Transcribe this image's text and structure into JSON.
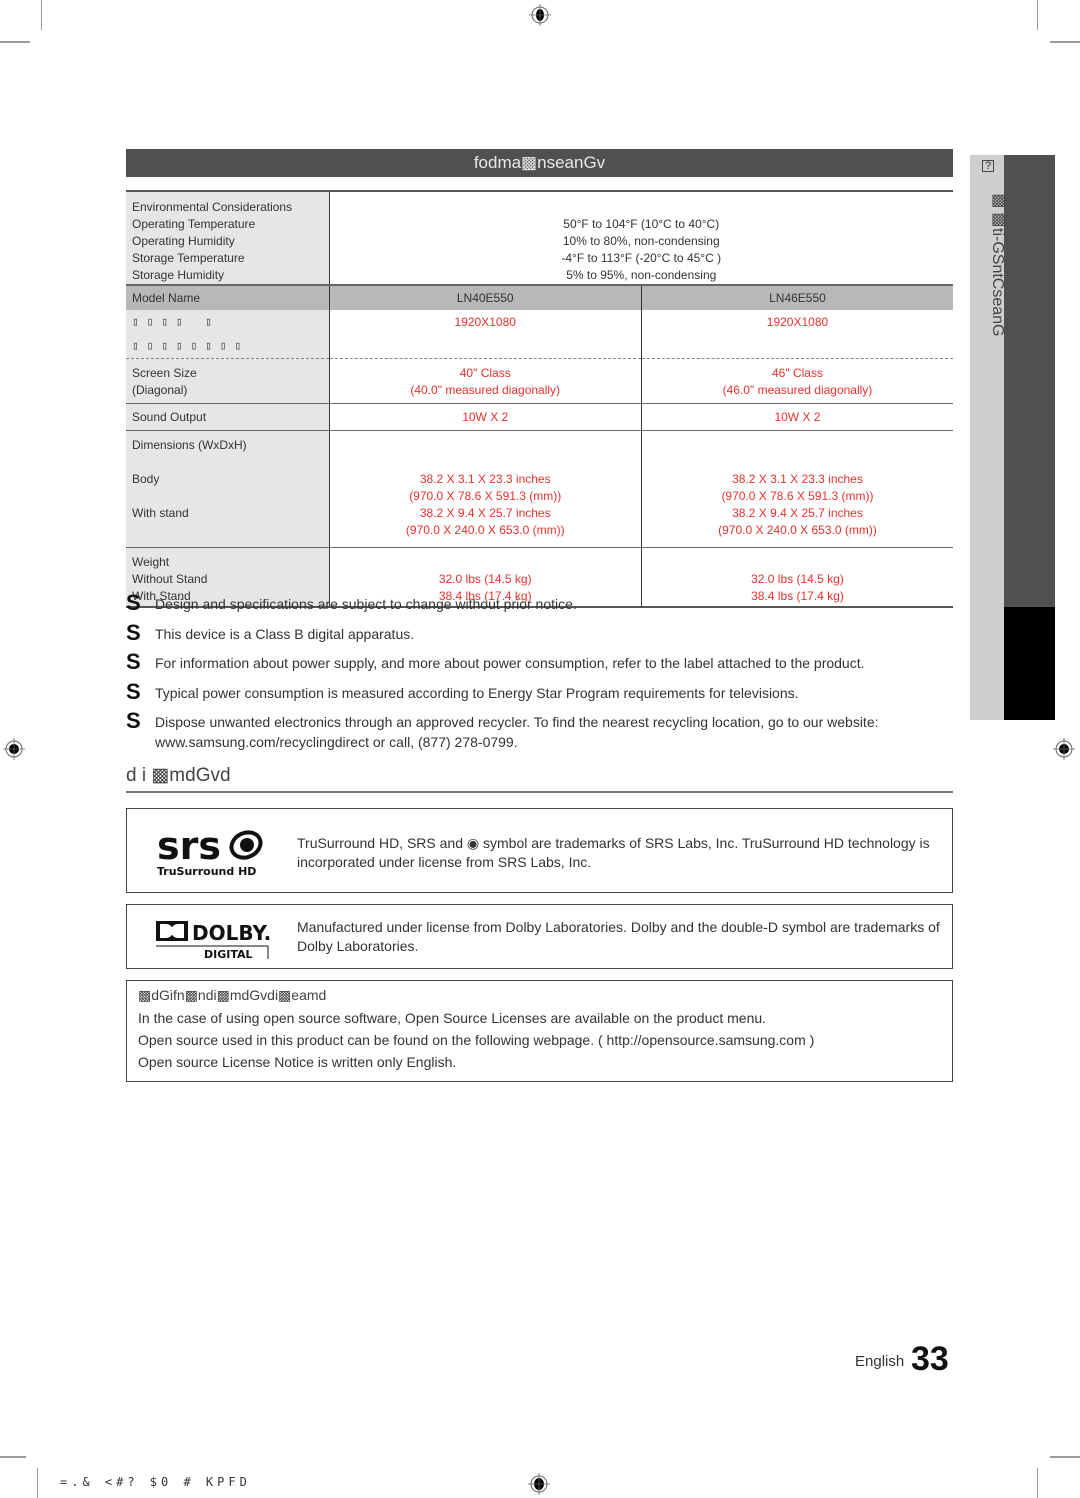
{
  "header": {
    "title": "fodma▩nseanGv"
  },
  "environmental": {
    "labels": [
      "Environmental Considerations",
      "Operating Temperature",
      "Operating Humidity",
      "Storage Temperature",
      "Storage Humidity"
    ],
    "values": [
      "",
      "50°F to 104°F (10°C to 40°C)",
      "10% to 80%, non-condensing",
      "-4°F to 113°F (-20°C to 45°C )",
      "5% to 95%, non-condensing"
    ]
  },
  "models": {
    "label": "Model Name",
    "names": [
      "LN40E550",
      "LN46E550"
    ]
  },
  "resolution": {
    "label": "▯▯▯▯ ▯ ▯▯▯▯▯▯▯▯",
    "values": [
      "1920X1080",
      "1920X1080"
    ]
  },
  "screen_size": {
    "label": "Screen Size",
    "sublabel": "(Diagonal)",
    "values": [
      {
        "class": "40\" Class",
        "measured": "(40.0\" measured diagonally)"
      },
      {
        "class": "46\" Class",
        "measured": "(46.0\" measured diagonally)"
      }
    ]
  },
  "sound": {
    "label": "Sound Output",
    "values": [
      "10W X 2",
      "10W X 2"
    ]
  },
  "dimensions": {
    "label": "Dimensions (WxDxH)",
    "body_label": "Body",
    "stand_label": "With stand",
    "values": [
      {
        "body_in": "38.2 X 3.1 X 23.3 inches",
        "body_mm": "(970.0 X 78.6 X 591.3 (mm))",
        "stand_in": "38.2 X 9.4 X 25.7 inches",
        "stand_mm": "(970.0 X 240.0 X 653.0 (mm))"
      },
      {
        "body_in": "38.2 X 3.1 X 23.3 inches",
        "body_mm": "(970.0 X 78.6 X 591.3 (mm))",
        "stand_in": "38.2 X 9.4 X 25.7 inches",
        "stand_mm": "(970.0 X 240.0 X 653.0 (mm))"
      }
    ]
  },
  "weight": {
    "label": "Weight",
    "without_label": "Without Stand",
    "with_label": "With Stand",
    "values": [
      {
        "without": "32.0 lbs (14.5 kg)",
        "with": "38.4 lbs (17.4 kg)"
      },
      {
        "without": "32.0 lbs (14.5 kg)",
        "with": "38.4 lbs (17.4 kg)"
      }
    ]
  },
  "notes": {
    "bullet": "S",
    "items": [
      "Design and specifications are subject to change without prior notice.",
      "This device is a Class B digital apparatus.",
      "For information about power supply, and more about power consumption, refer to the label attached to the product.",
      "Typical power consumption is measured according to Energy Star Program requirements for televisions.",
      "Dispose unwanted electronics through an approved recycler. To find the nearest recycling location, go to our website: www.samsung.com/recyclingdirect or call, (877) 278-0799."
    ]
  },
  "licence": {
    "heading": "d i ▩mdGvd",
    "srs": {
      "logo_text": "srs",
      "logo_sub": "TruSurround HD",
      "text": "TruSurround HD, SRS and ◉ symbol are trademarks of SRS Labs, Inc. TruSurround HD technology is incorporated under license from SRS Labs, Inc."
    },
    "dolby": {
      "logo_text": "DOLBY.",
      "logo_sub": "DIGITAL",
      "text": "Manufactured under license from Dolby Laboratories. Dolby and the double-D symbol are trademarks of Dolby Laboratories."
    },
    "open_source": {
      "title": "▩dGifn▩ndi▩mdGvdi▩eamd",
      "lines": [
        "In the case of using open source software, Open Source Licenses are available on the product menu.",
        "Open source used in this product can be found on the following webpage. ( http://opensource.samsung.com )",
        "Open source License Notice is written only English."
      ]
    }
  },
  "side_tab": {
    "number": "?",
    "label": "▩▩ti-GSntCseanG"
  },
  "page": {
    "language": "English",
    "number": "33"
  },
  "footer": {
    "code": "=.&   <#? $0     # KPFD"
  }
}
